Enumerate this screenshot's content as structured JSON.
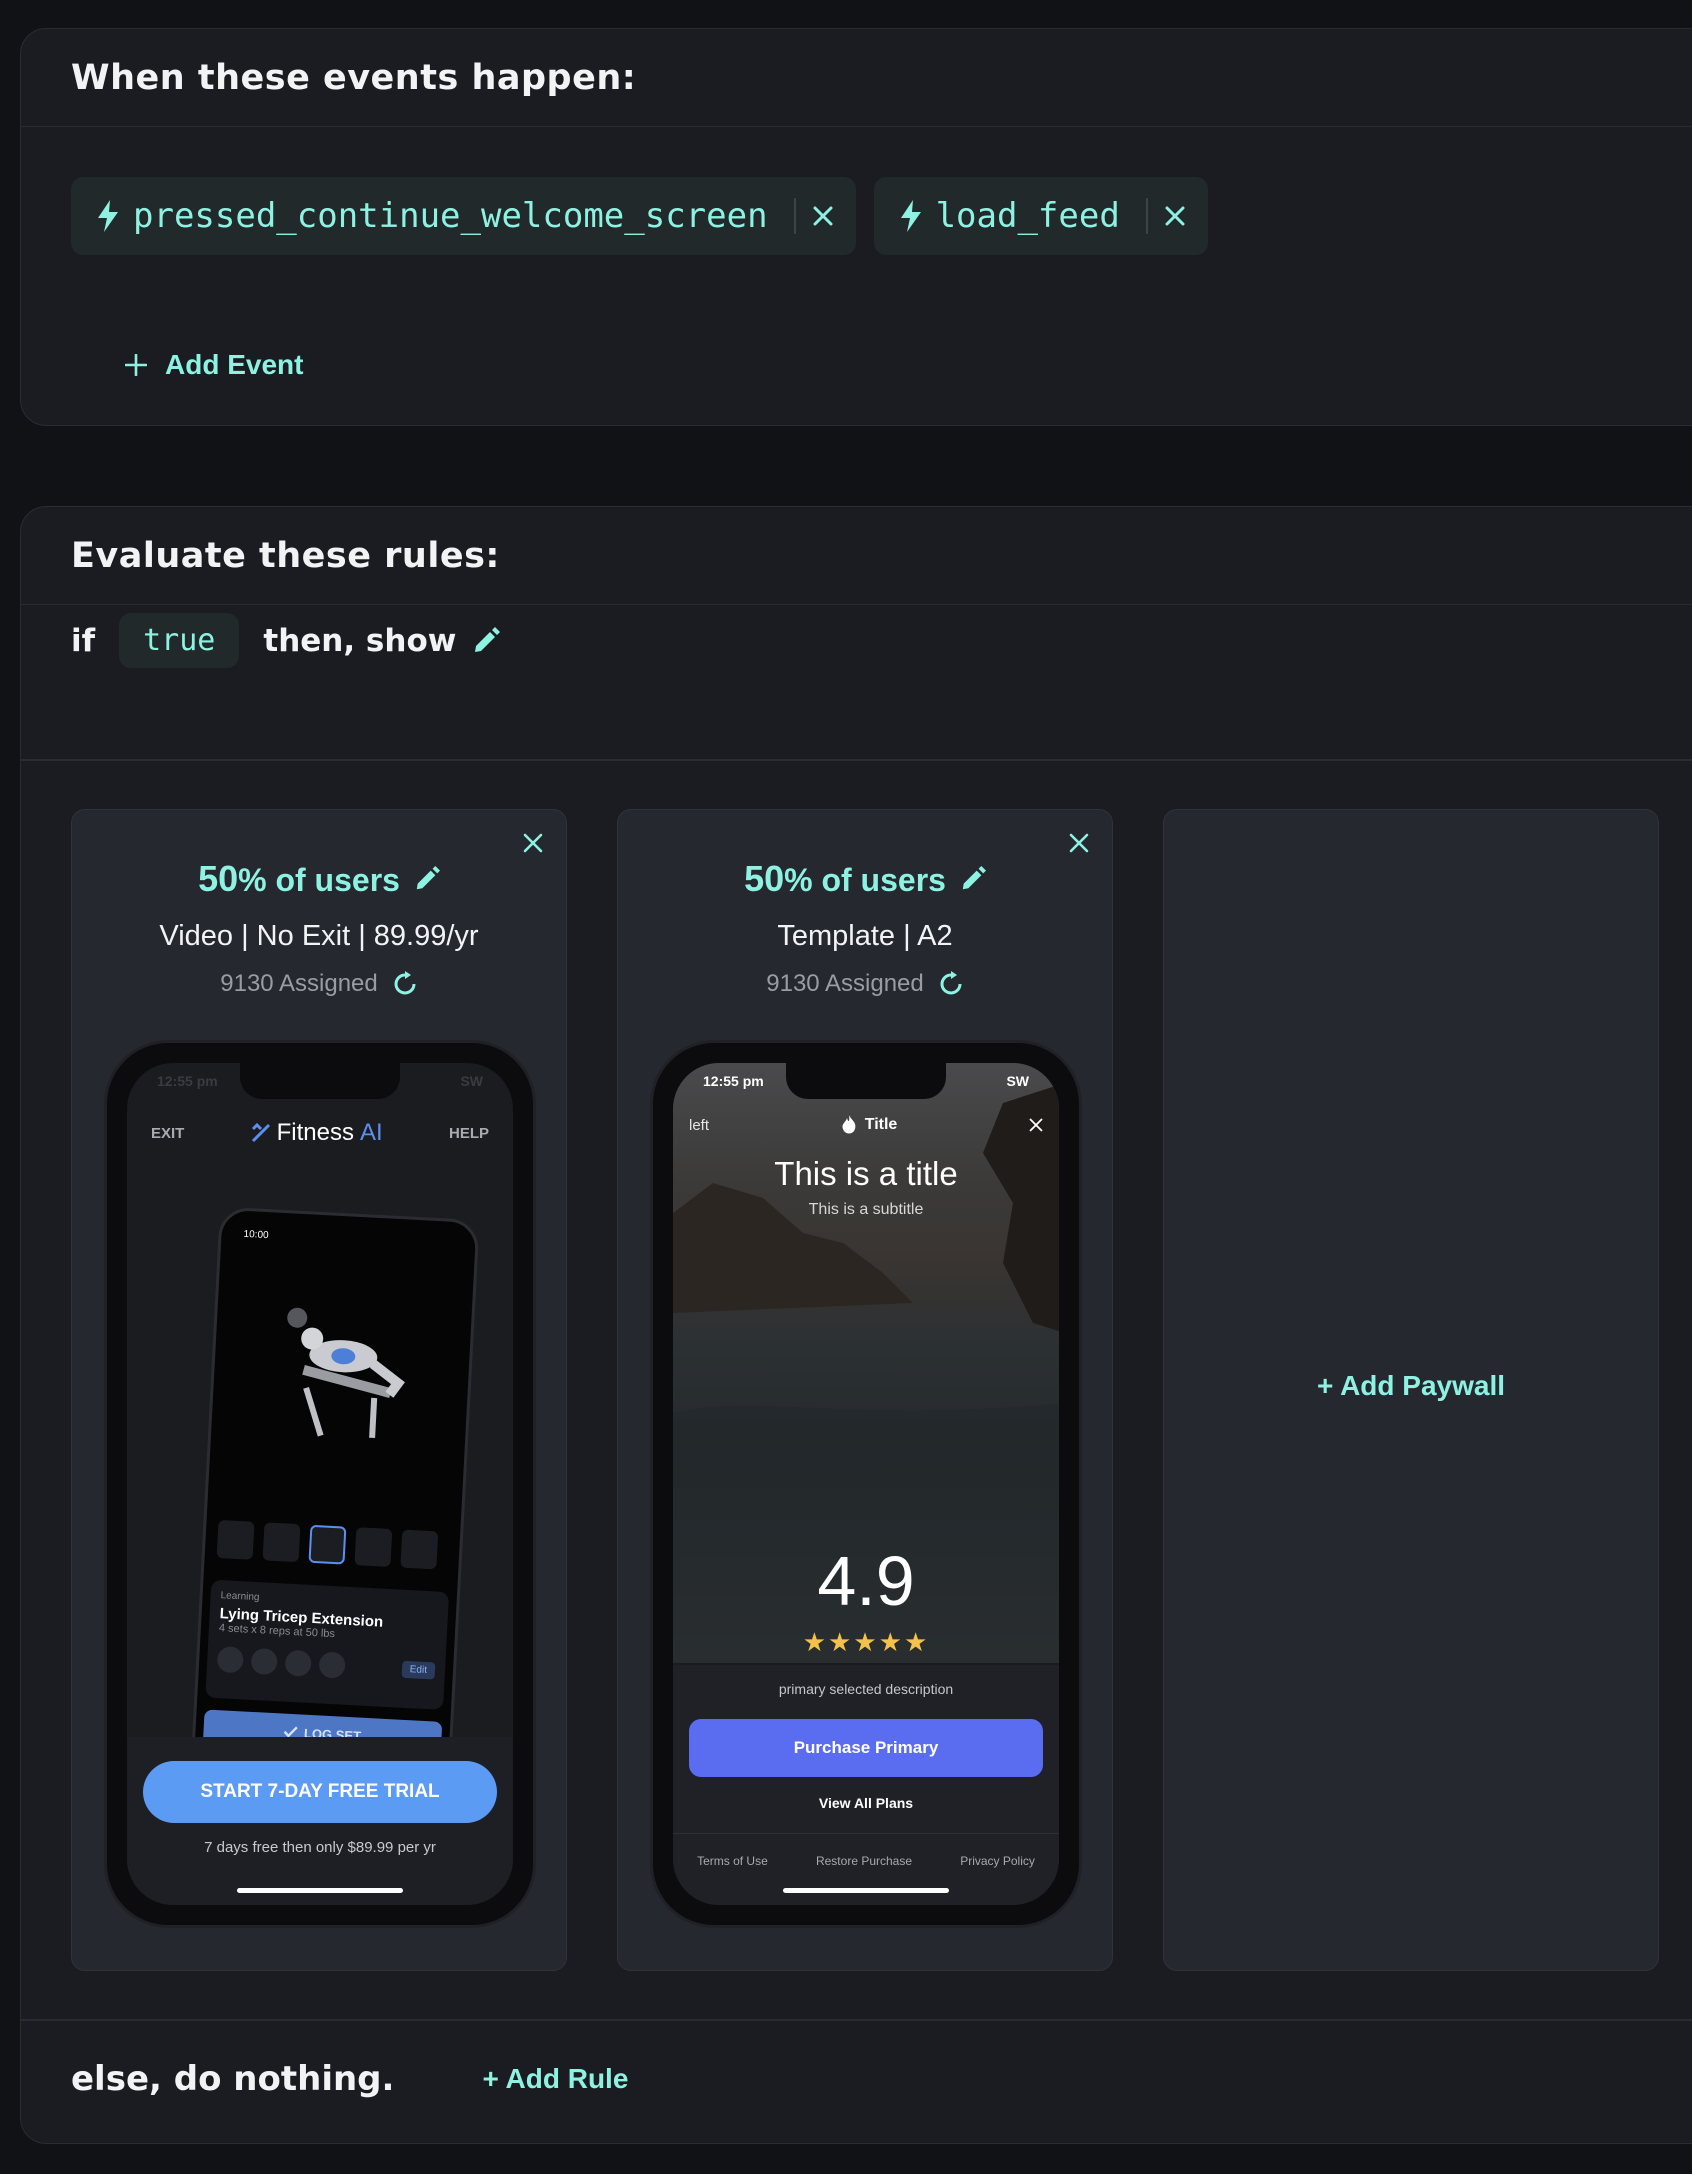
{
  "events_card": {
    "title": "When these events happen:",
    "events": [
      {
        "name": "pressed_continue_welcome_screen"
      },
      {
        "name": "load_feed"
      }
    ],
    "add_event_label": "Add Event"
  },
  "rules_card": {
    "title": "Evaluate these rules:",
    "rule": {
      "if_label": "if",
      "condition": "true",
      "then_label": "then, show"
    },
    "variants": [
      {
        "percent": "50",
        "percent_suffix": "% of users",
        "name": "Video | No Exit | 89.99/yr",
        "assigned": "9130 Assigned",
        "preview": {
          "time": "12:55 pm",
          "carrier": "SW",
          "exit": "EXIT",
          "help": "HELP",
          "logo_main": "Fitness",
          "logo_accent": "AI",
          "inner_time": "10:00",
          "learning_tag": "Learning",
          "exercise_title": "Lying Tricep Extension",
          "exercise_sub": "4 sets x 8 reps at 50 lbs",
          "edit_label": "Edit",
          "log_set": "LOG SET",
          "cta": "START 7-DAY FREE TRIAL",
          "cta_note": "7 days free then only $89.99 per yr"
        }
      },
      {
        "percent": "50",
        "percent_suffix": "% of users",
        "name": "Template | A2",
        "assigned": "9130 Assigned",
        "preview": {
          "time": "12:55 pm",
          "carrier": "SW",
          "left": "left",
          "top_title": "Title",
          "title": "This is a title",
          "subtitle": "This is a subtitle",
          "rating": "4.9",
          "stars": "★★★★★",
          "description": "primary selected description",
          "purchase": "Purchase Primary",
          "view_all": "View All Plans",
          "terms": "Terms of Use",
          "restore": "Restore Purchase",
          "privacy": "Privacy Policy"
        }
      }
    ],
    "add_paywall_label": "+ Add Paywall",
    "else_label": "else, do nothing.",
    "add_rule_label": "+ Add Rule"
  },
  "colors": {
    "accent": "#8ef2e3",
    "background": "#111216",
    "card": "#1b1c21",
    "panel": "#262830",
    "purchase_button": "#5a6df0",
    "trial_button": "#5b9bf4",
    "star": "#f3c24a"
  }
}
